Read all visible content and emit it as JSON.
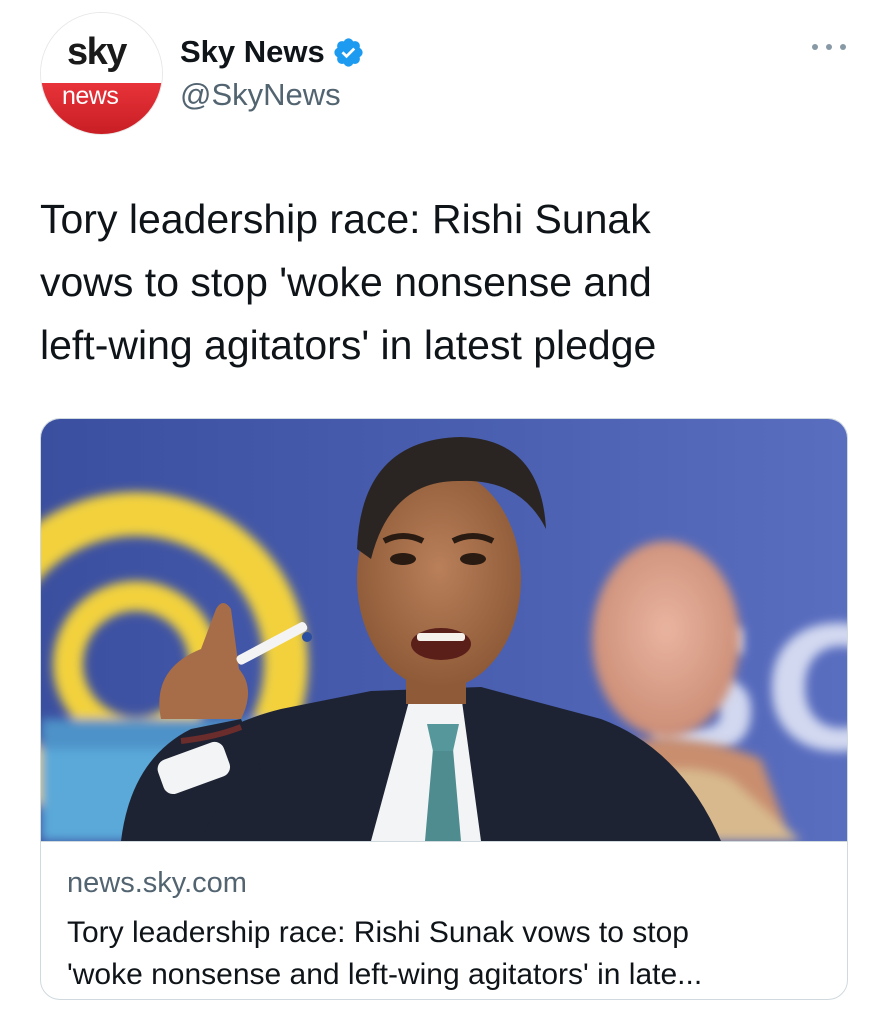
{
  "author": {
    "display_name": "Sky News",
    "handle": "@SkyNews",
    "verified": true,
    "avatar_logo": {
      "top_word": "sky",
      "bottom_word": "news"
    }
  },
  "tweet": {
    "text": "Tory leadership race: Rishi Sunak\nvows to stop 'woke nonsense and\nleft-wing agitators' in latest pledge"
  },
  "card": {
    "image_icon": "photo-of-man-pointing-icon",
    "domain": "news.sky.com",
    "title": "Tory leadership race: Rishi Sunak vows to stop\n'woke nonsense and left-wing agitators' in late..."
  },
  "icons": {
    "verified": "verified-badge-icon",
    "more": "more-options-icon"
  },
  "colors": {
    "verified_blue": "#1d9bf0",
    "sky_red": "#d8262c",
    "secondary_text": "#536471",
    "card_border": "#cfd9de"
  }
}
